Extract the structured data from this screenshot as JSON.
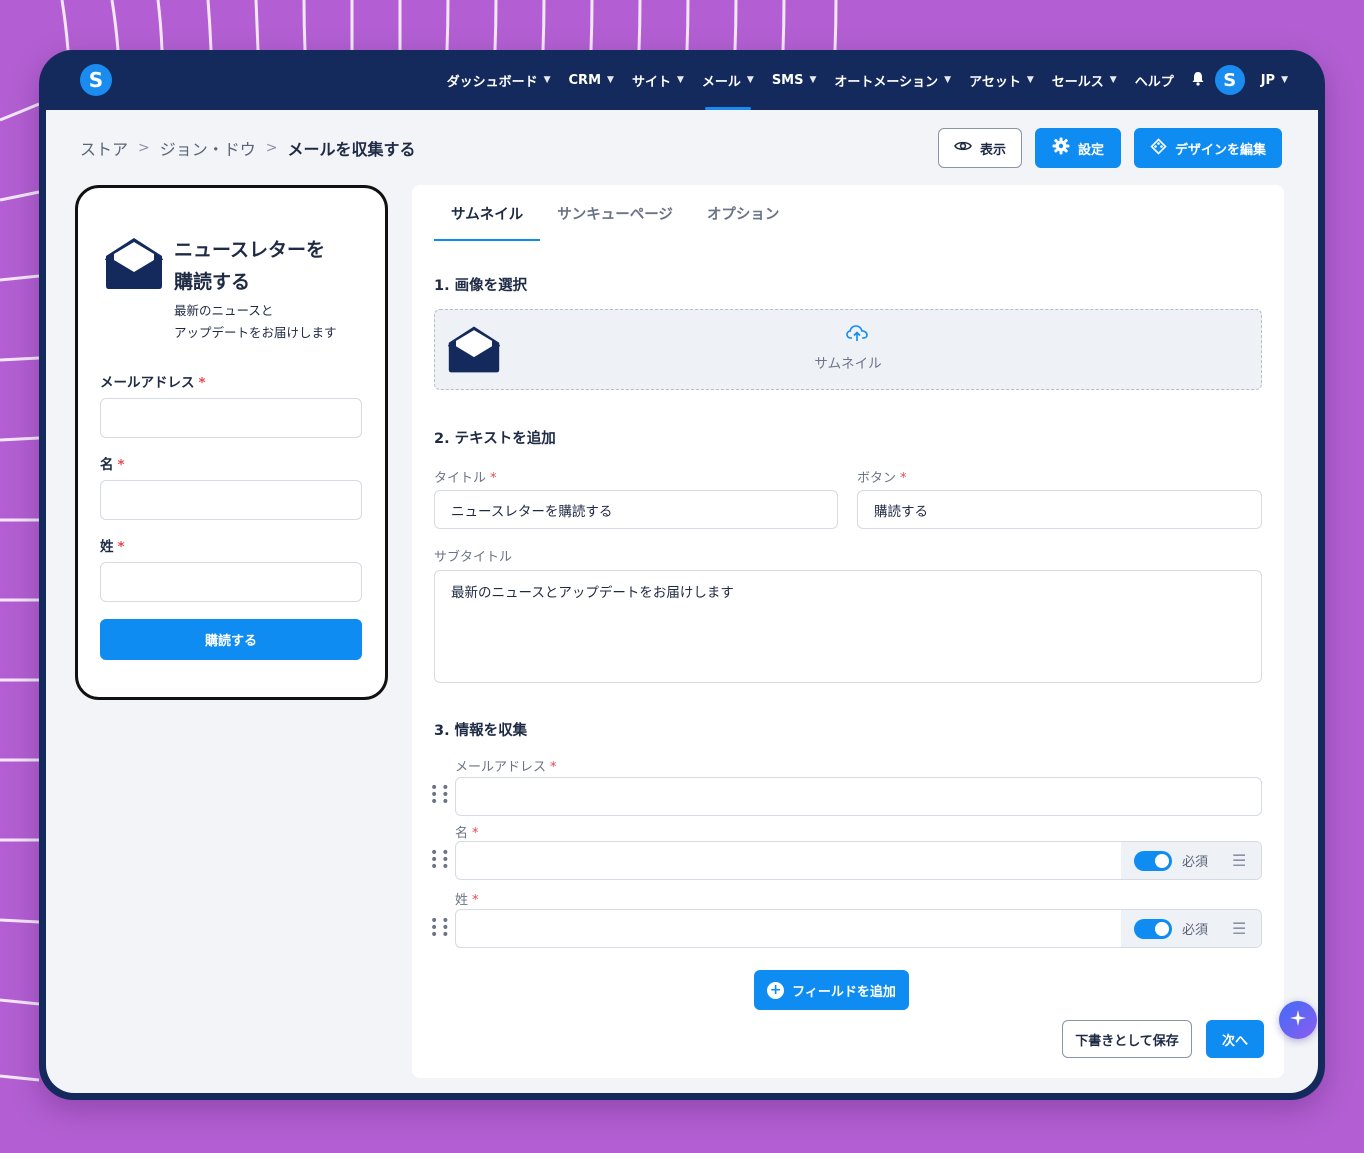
{
  "nav": {
    "items": [
      {
        "label": "ダッシュボード",
        "active": false
      },
      {
        "label": "CRM",
        "active": false
      },
      {
        "label": "サイト",
        "active": false
      },
      {
        "label": "メール",
        "active": true
      },
      {
        "label": "SMS",
        "active": false
      },
      {
        "label": "オートメーション",
        "active": false
      },
      {
        "label": "アセット",
        "active": false
      },
      {
        "label": "セールス",
        "active": false
      }
    ],
    "help": "ヘルプ",
    "logo_letter": "S",
    "avatar_letter": "S",
    "language": "JP"
  },
  "breadcrumb": [
    "ストア",
    "ジョン・ドウ",
    "メールを収集する"
  ],
  "toolbar": {
    "preview_label": "表示",
    "settings_label": "設定",
    "edit_design_label": "デザインを編集"
  },
  "preview": {
    "title_line1": "ニュースレターを",
    "title_line2": "購読する",
    "subtitle_line1": "最新のニュースと",
    "subtitle_line2": "アップデートをお届けします",
    "email_label": "メールアドレス",
    "first_name_label": "名",
    "last_name_label": "姓",
    "submit_label": "購読する",
    "required_mark": "*"
  },
  "tabs": [
    "サムネイル",
    "サンキューページ",
    "オプション"
  ],
  "active_tab": "サムネイル",
  "sections": {
    "image": "1. 画像を選択",
    "text": "2. テキストを追加",
    "collect": "3. 情報を収集"
  },
  "dropzone": {
    "label": "サムネイル"
  },
  "text_fields": {
    "title_label": "タイトル",
    "title_value": "ニュースレターを購読する",
    "button_label": "ボタン",
    "button_value": "購読する",
    "subtitle_label": "サブタイトル",
    "subtitle_value": "最新のニュースとアップデートをお届けします"
  },
  "collect_fields": [
    {
      "label": "メールアドレス",
      "required_toggle": false
    },
    {
      "label": "名",
      "required_toggle": true,
      "toggle_label": "必須"
    },
    {
      "label": "姓",
      "required_toggle": true,
      "toggle_label": "必須"
    }
  ],
  "actions": {
    "add_field": "フィールドを追加",
    "save_draft": "下書きとして保存",
    "next": "次へ"
  },
  "colors": {
    "background": "#b35fd3",
    "navbar": "#152a5c",
    "primary": "#0f8cf2",
    "required": "#e5484d"
  }
}
